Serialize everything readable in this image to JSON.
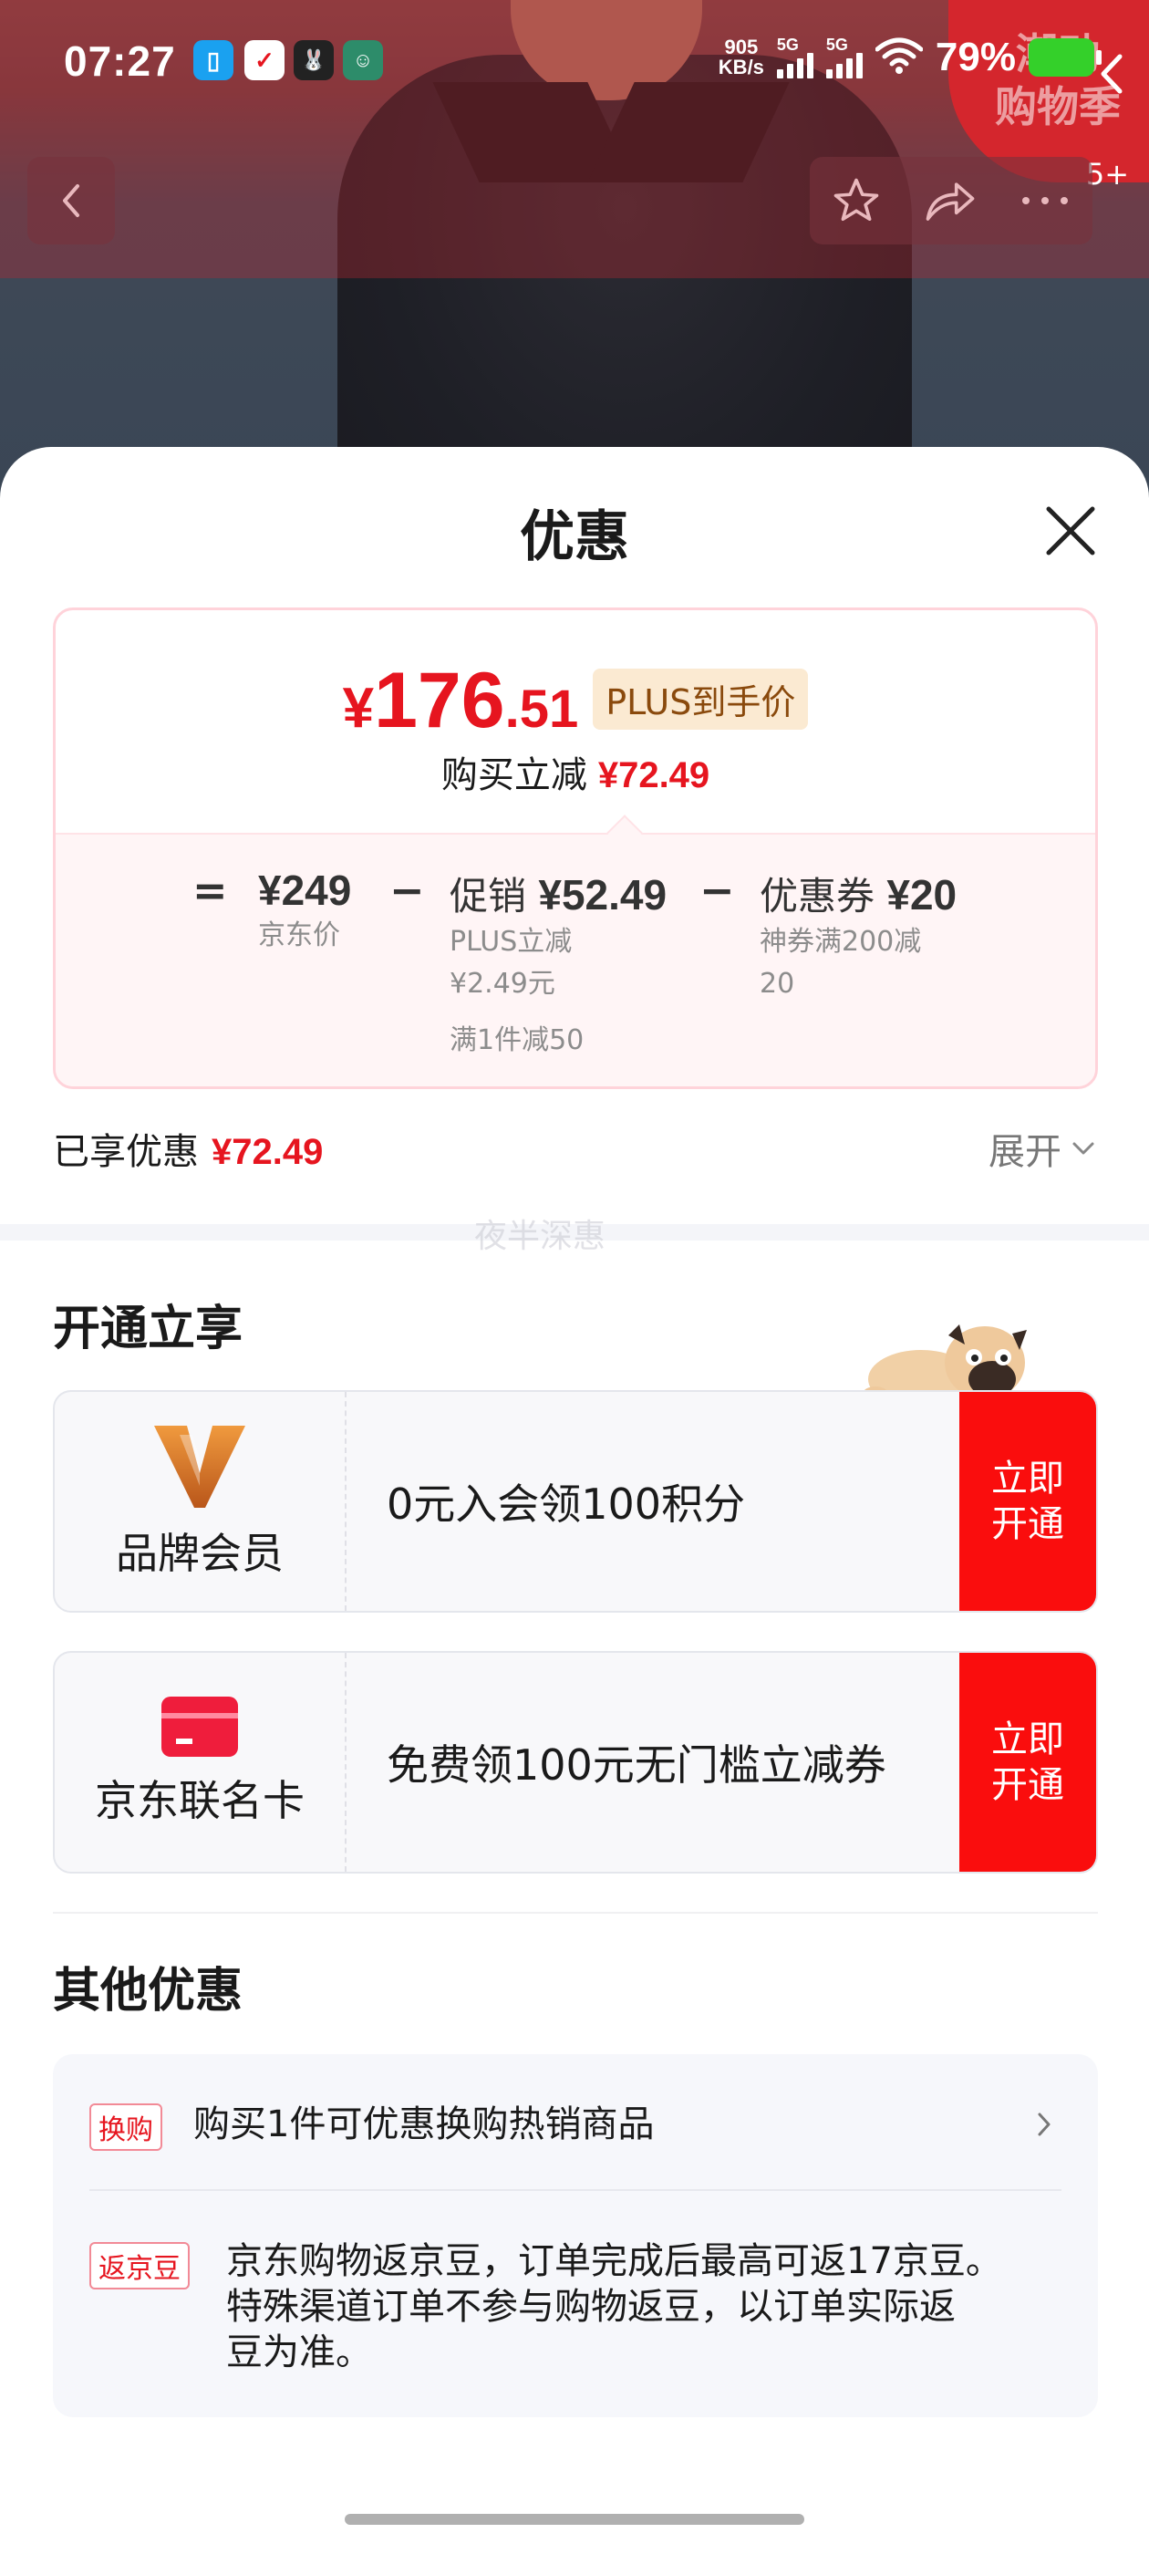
{
  "status_bar": {
    "time": "07:27",
    "net_speed_value": "905",
    "net_speed_unit": "KB/s",
    "signal1_label": "5G",
    "signal2_label": "5G",
    "battery_percent": "79%",
    "app_icons": [
      "phone-app-icon",
      "jd-app-icon",
      "bunny-app-icon",
      "avatar-app-icon"
    ]
  },
  "promo_badge": {
    "line1": "潮动",
    "line2": "购物季",
    "count": "5+"
  },
  "sheet": {
    "title": "优惠",
    "price": {
      "currency": "¥",
      "integer": "176",
      "decimal": ".51"
    },
    "plus_tag": "PLUS到手价",
    "reduce_label": "购买立减",
    "reduce_amount": "¥72.49",
    "breakdown": {
      "eq": "=",
      "minus": "−",
      "jd_price": "¥249",
      "jd_price_label": "京东价",
      "promo_label": "促销",
      "promo_amount": "¥52.49",
      "promo_sub1": "PLUS立减",
      "promo_sub2": "¥2.49元",
      "promo_sub3": "满1件减50",
      "coupon_label": "优惠券",
      "coupon_amount": "¥20",
      "coupon_sub1": "神券满200减",
      "coupon_sub2": "20"
    },
    "enjoyed_label": "已享优惠",
    "enjoyed_amount": "¥72.49",
    "expand_label": "展开",
    "watermark": "夜半深惠"
  },
  "open_section": {
    "title": "开通立享",
    "cards": [
      {
        "name": "品牌会员",
        "desc": "0元入会领100积分",
        "btn_line1": "立即",
        "btn_line2": "开通"
      },
      {
        "name": "京东联名卡",
        "desc": "免费领100元无门槛立减券",
        "btn_line1": "立即",
        "btn_line2": "开通"
      }
    ]
  },
  "other_section": {
    "title": "其他优惠",
    "items": [
      {
        "tag": "换购",
        "line1": "购买1件可优惠换购热销商品"
      },
      {
        "tag": "返京豆",
        "line1": "京东购物返京豆，订单完成后最高可返17京豆。",
        "line2": "特殊渠道订单不参与购物返豆，以订单实际返",
        "line3": "豆为准。"
      }
    ]
  },
  "colors": {
    "accent_red": "#e6151f",
    "button_red": "#fa0d0d",
    "plus_tag_bg": "#fbead2",
    "battery_green": "#34d02a"
  }
}
